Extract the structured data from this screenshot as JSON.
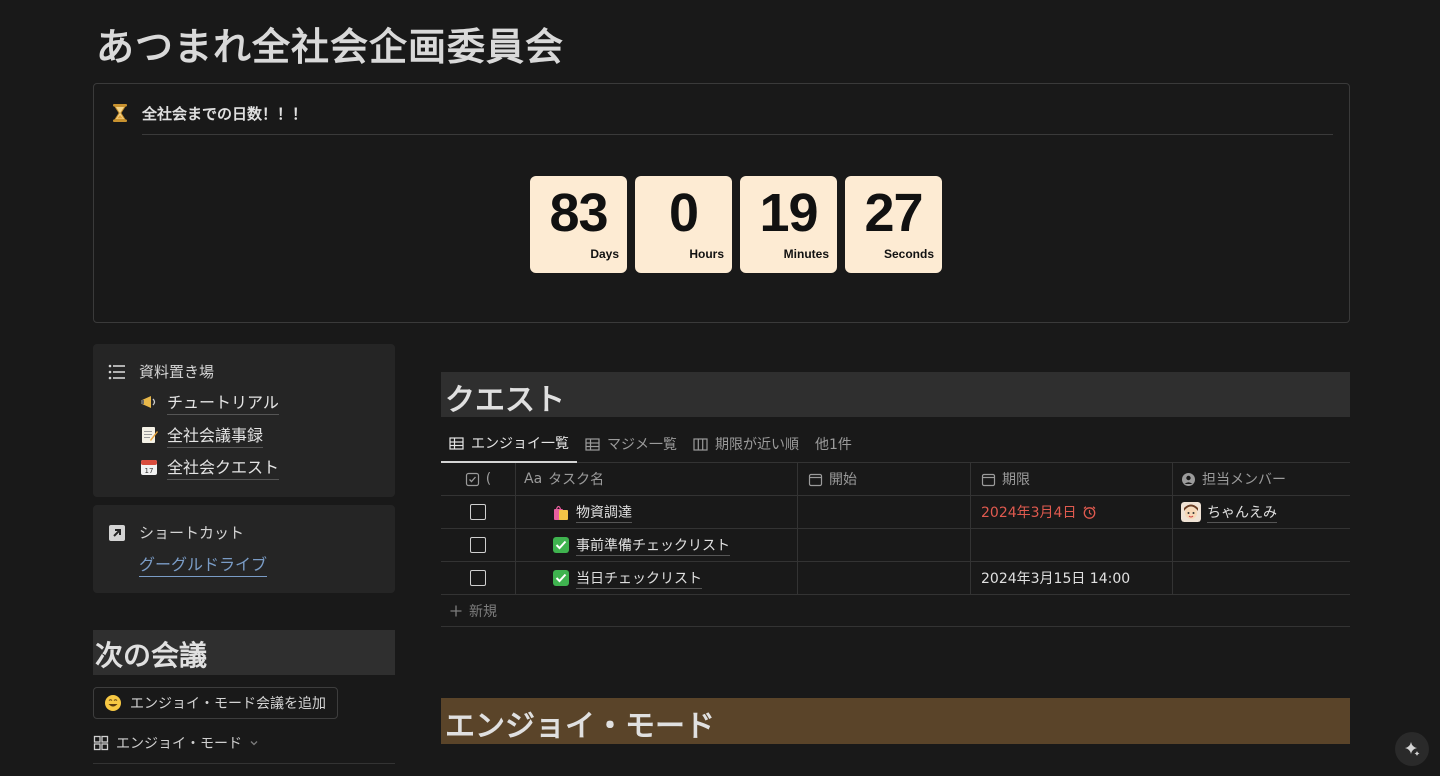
{
  "page": {
    "title": "あつまれ全社会企画委員会"
  },
  "countdown": {
    "title": "全社会までの日数！！！",
    "icon": "hourglass-icon",
    "tile_color": "#fdebd3",
    "tiles": [
      {
        "value": "83",
        "unit": "Days"
      },
      {
        "value": "0",
        "unit": "Hours"
      },
      {
        "value": "19",
        "unit": "Minutes"
      },
      {
        "value": "27",
        "unit": "Seconds"
      }
    ]
  },
  "resources": {
    "heading": "資料置き場",
    "items": [
      {
        "label": "チュートリアル",
        "icon": "megaphone-icon"
      },
      {
        "label": "全社会議事録",
        "icon": "memo-icon"
      },
      {
        "label": "全社会クエスト",
        "icon": "calendar-icon"
      }
    ]
  },
  "shortcut": {
    "heading": "ショートカット",
    "link": "グーグルドライブ",
    "link_color": "#7a9cc6"
  },
  "next_meeting": {
    "heading": "次の会議",
    "add_button": "エンジョイ・モード会議を追加",
    "view": "エンジョイ・モード"
  },
  "quest": {
    "heading": "クエスト",
    "tabs": [
      {
        "label": "エンジョイ一覧",
        "active": true
      },
      {
        "label": "マジメ一覧",
        "active": false
      },
      {
        "label": "期限が近い順",
        "active": false
      },
      {
        "label": "他1件",
        "active": false
      }
    ],
    "columns": {
      "done": "(",
      "name_prefix": "Aa",
      "name": "タスク名",
      "start": "開始",
      "due": "期限",
      "member": "担当メンバー"
    },
    "rows": [
      {
        "name": "物資調達",
        "icon": "shopping-bags-icon",
        "start": "",
        "due": "2024年3月4日",
        "overdue": true,
        "member": "ちゃんえみ"
      },
      {
        "name": "事前準備チェックリスト",
        "icon": "check-mark-icon",
        "start": "",
        "due": "",
        "overdue": false,
        "member": ""
      },
      {
        "name": "当日チェックリスト",
        "icon": "check-mark-icon",
        "start": "",
        "due": "2024年3月15日 14:00",
        "overdue": false,
        "member": ""
      }
    ],
    "new_label": "新規",
    "overdue_color": "#e05a4f"
  },
  "enjoy_mode": {
    "heading": "エンジョイ・モード",
    "color": "#5a4429"
  }
}
